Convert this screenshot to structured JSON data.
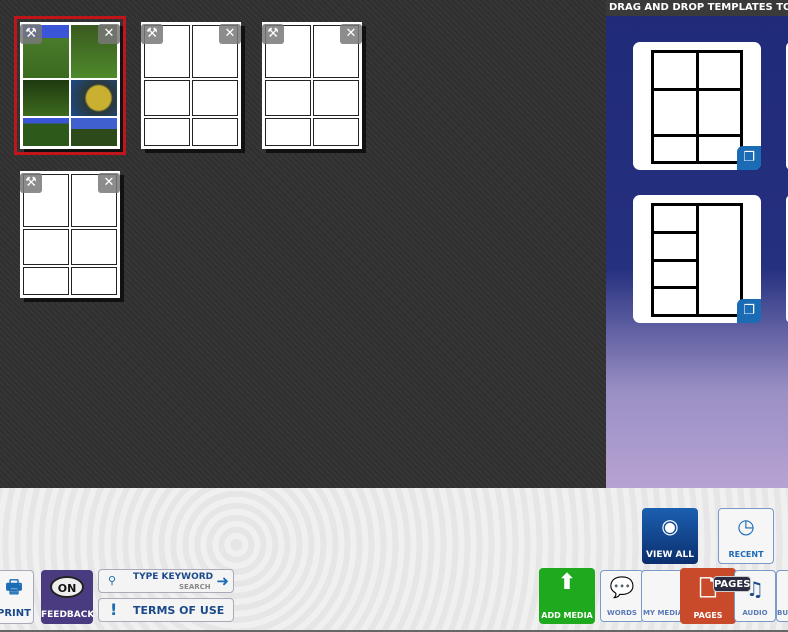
{
  "pages": [
    {
      "id": "page-1",
      "selected": true,
      "has_media": true
    },
    {
      "id": "page-2"
    },
    {
      "id": "page-3"
    },
    {
      "id": "page-4"
    }
  ],
  "page_controls": {
    "edit_icon": "hammer-icon",
    "delete_icon": "close-icon"
  },
  "templates_panel": {
    "title": "DRAG AND DROP TEMPLATES TO A",
    "templates": [
      {
        "layout": "2x3-grid"
      },
      {
        "layout": "4-left-1-right"
      }
    ]
  },
  "toolbar": {
    "print": "PRINT",
    "feedback": "FEEDBACK",
    "feedback_badge": "ON",
    "search_placeholder": "TYPE KEYWORD",
    "search_sub": "SEARCH",
    "terms": "TERMS OF USE",
    "terms_icon": "!",
    "view_all": "VIEW ALL",
    "recent": "RECENT",
    "add_media": "ADD MEDIA",
    "tabs": [
      "WORDS",
      "MY MEDIA",
      "PAGES",
      "AUDIO",
      "BUILD"
    ],
    "active_tab": "PAGES",
    "tooltip": "PAGES"
  },
  "colors": {
    "selected_page": "#c0161b",
    "panel": "#1f2a78",
    "add_media": "#1fa91f",
    "pages_tab": "#c84a2a",
    "feedback": "#4a3a7f",
    "view_all": "#0c2f6e"
  }
}
